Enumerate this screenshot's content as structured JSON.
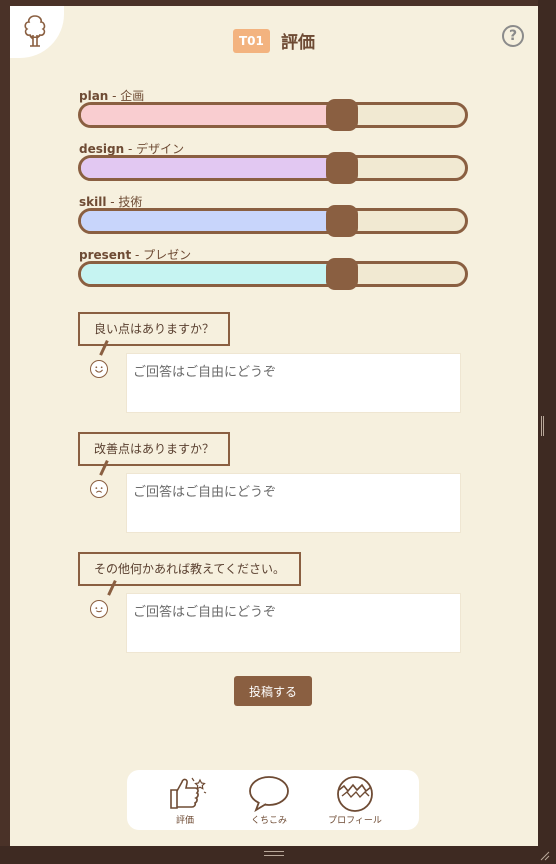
{
  "header": {
    "team_badge": "T01",
    "title": "評価",
    "help_label": "?"
  },
  "sliders": [
    {
      "key": "plan",
      "label": " - 企画",
      "value": 0.68,
      "fill_color": "#f9cdd0"
    },
    {
      "key": "design",
      "label": " - デザイン",
      "value": 0.68,
      "fill_color": "#e2c8f2"
    },
    {
      "key": "skill",
      "label": " - 技術",
      "value": 0.68,
      "fill_color": "#c8d5fb"
    },
    {
      "key": "present",
      "label": " - プレゼン",
      "value": 0.68,
      "fill_color": "#c6f4f2"
    }
  ],
  "questions": [
    {
      "question": "良い点はありますか？",
      "placeholder": "ご回答はご自由にどうぞ",
      "face": "happy-face-icon"
    },
    {
      "question": "改善点はありますか？",
      "placeholder": "ご回答はご自由にどうぞ",
      "face": "sad-face-icon"
    },
    {
      "question": "その他何かあれば教えてください。",
      "placeholder": "ご回答はご自由にどうぞ",
      "face": "smile-face-icon"
    }
  ],
  "submit_label": "投稿する",
  "nav": [
    {
      "label": "評価",
      "icon": "thumbs-up-icon"
    },
    {
      "label": "くちこみ",
      "icon": "speech-bubble-icon"
    },
    {
      "label": "プロフィール",
      "icon": "egg-icon"
    }
  ],
  "colors": {
    "accent": "#8a5f41",
    "background": "#f6f0de",
    "badge": "#f3b37f",
    "frame": "#4a3228"
  }
}
